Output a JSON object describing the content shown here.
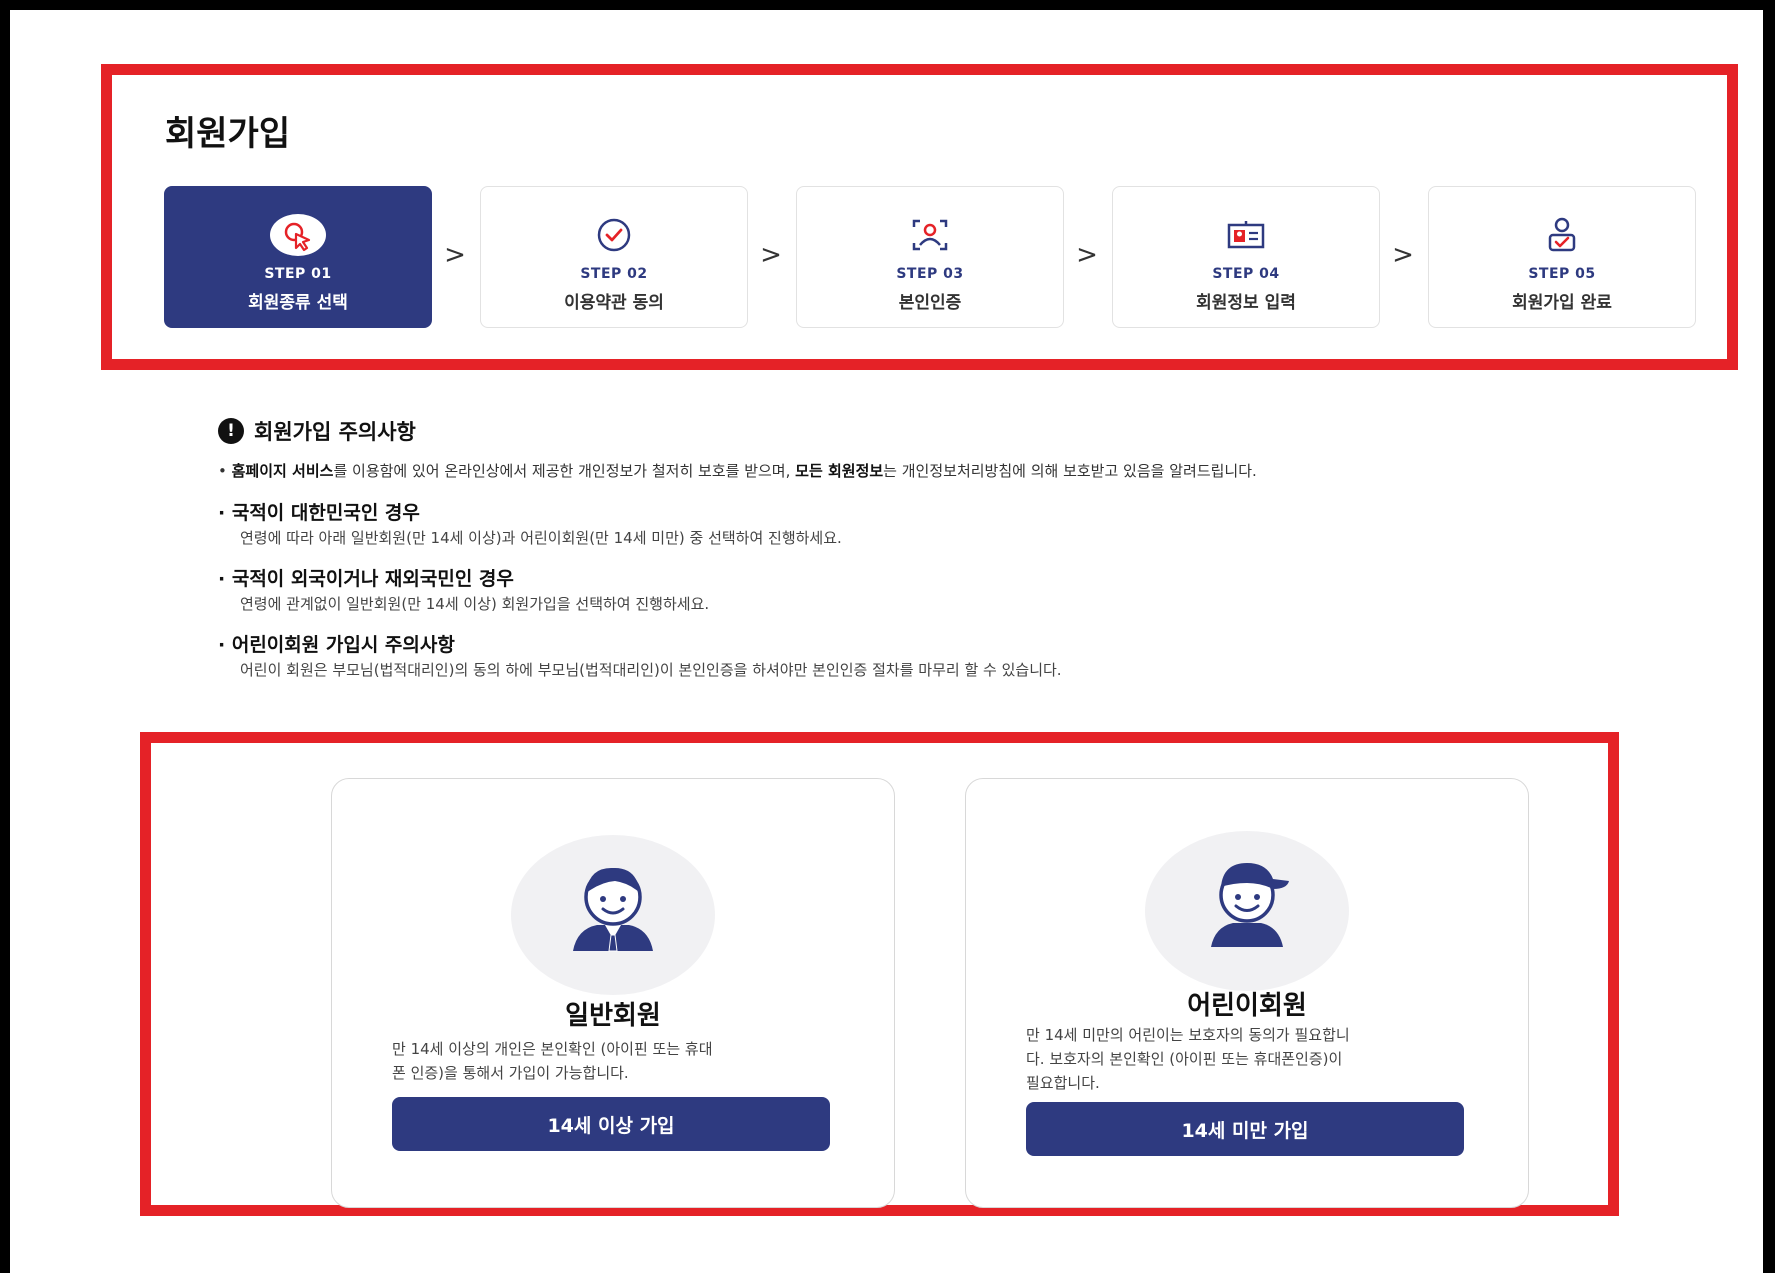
{
  "page": {
    "title": "회원가입"
  },
  "steps": [
    {
      "num": "STEP 01",
      "label": "회원종류 선택",
      "icon": "cursor-click-icon",
      "active": true
    },
    {
      "num": "STEP 02",
      "label": "이용약관 동의",
      "icon": "check-circle-icon",
      "active": false
    },
    {
      "num": "STEP 03",
      "label": "본인인증",
      "icon": "face-scan-icon",
      "active": false
    },
    {
      "num": "STEP 04",
      "label": "회원정보 입력",
      "icon": "id-card-icon",
      "active": false
    },
    {
      "num": "STEP 05",
      "label": "회원가입 완료",
      "icon": "user-check-icon",
      "active": false
    }
  ],
  "arrow": ">",
  "notice": {
    "title": "회원가입 주의사항",
    "intro": {
      "bold1": "홈페이지 서비스",
      "text1": "를 이용함에 있어 온라인상에서 제공한 개인정보가 철저히 보호를 받으며, ",
      "bold2": "모든 회원정보",
      "text2": "는 개인정보처리방침에 의해 보호받고 있음을 알려드립니다."
    },
    "items": [
      {
        "head": "국적이 대한민국인 경우",
        "desc": "연령에 따라 아래 일반회원(만 14세 이상)과 어린이회원(만 14세 미만) 중 선택하여 진행하세요."
      },
      {
        "head": "국적이 외국이거나 재외국민인 경우",
        "desc": "연령에 관계없이 일반회원(만 14세 이상) 회원가입을 선택하여 진행하세요."
      },
      {
        "head": "어린이회원 가입시 주의사항",
        "desc": "어린이 회원은 부모님(법적대리인)의 동의 하에 부모님(법적대리인)이 본인인증을 하셔야만 본인인증 절차를 마무리 할 수 있습니다."
      }
    ]
  },
  "cards": {
    "general": {
      "title": "일반회원",
      "desc_line1": "만 14세 이상의 개인은 본인확인 (아이핀 또는 휴대",
      "desc_line2": "폰 인증)을 통해서 가입이 가능합니다.",
      "button": "14세 이상 가입"
    },
    "child": {
      "title": "어린이회원",
      "desc_line1": "만 14세 미만의 어린이는 보호자의 동의가 필요합니",
      "desc_line2": "다. 보호자의 본인확인 (아이핀 또는 휴대폰인증)이",
      "desc_line3": "필요합니다.",
      "button": "14세 미만 가입"
    }
  },
  "colors": {
    "primary": "#2e3a80",
    "highlight": "#e52227",
    "step_icon_accent": "#e52227"
  }
}
